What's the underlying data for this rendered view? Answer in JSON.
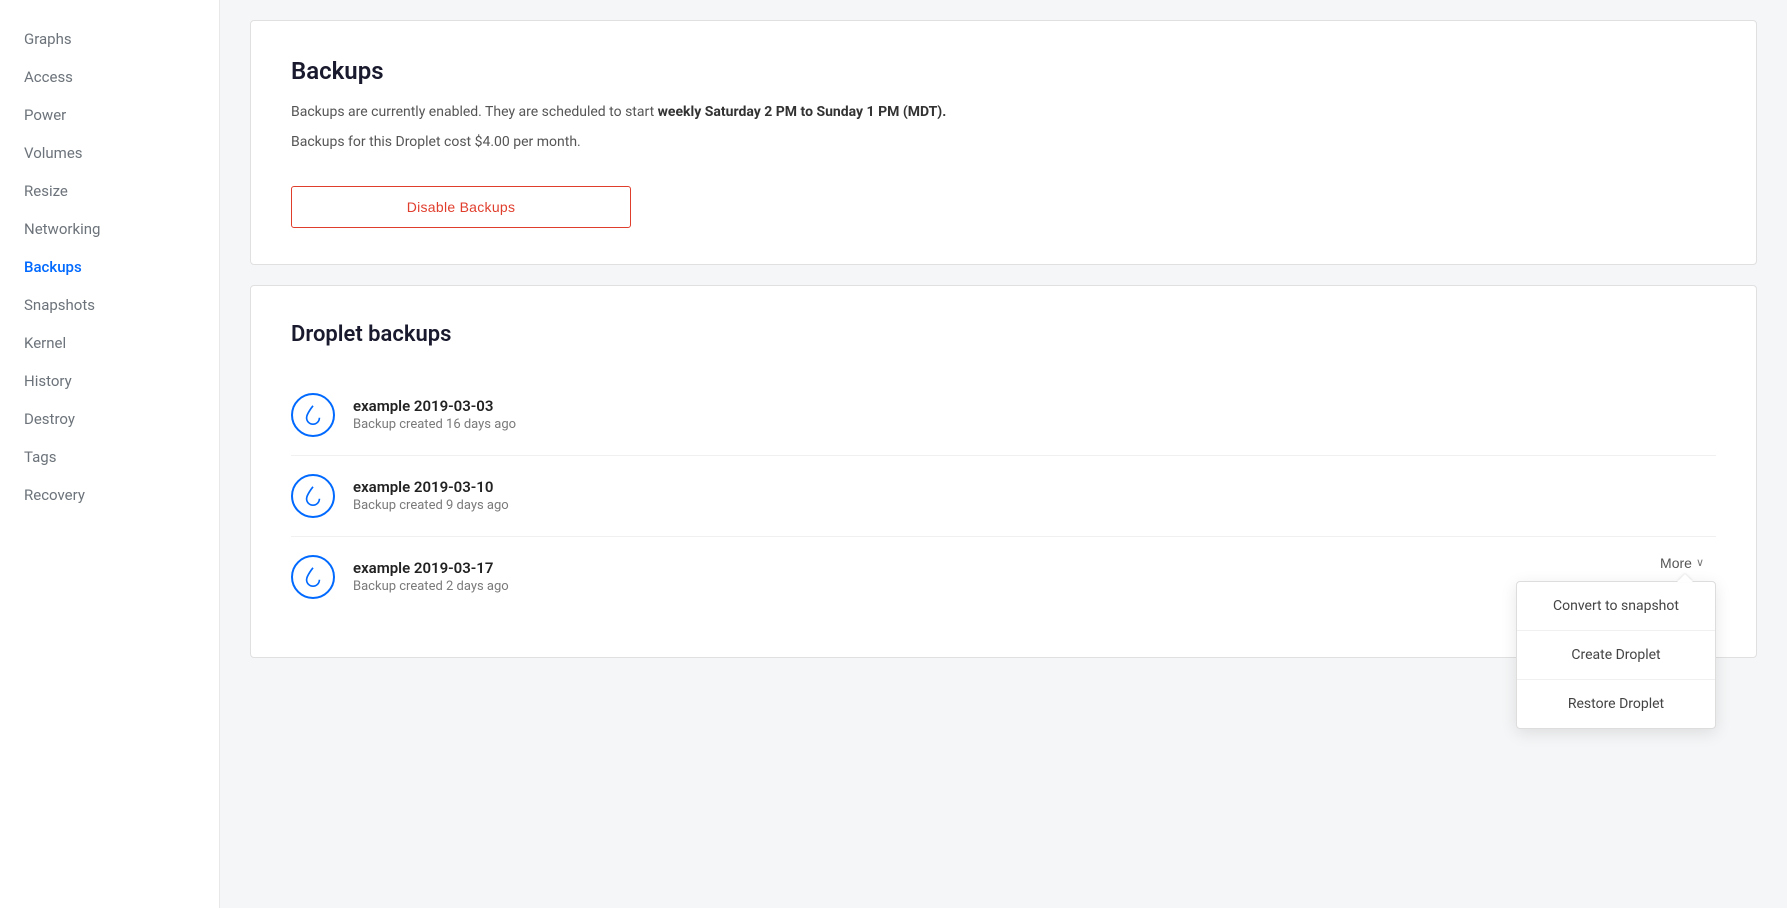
{
  "sidebar": {
    "items": [
      {
        "id": "graphs",
        "label": "Graphs",
        "active": false
      },
      {
        "id": "access",
        "label": "Access",
        "active": false
      },
      {
        "id": "power",
        "label": "Power",
        "active": false
      },
      {
        "id": "volumes",
        "label": "Volumes",
        "active": false
      },
      {
        "id": "resize",
        "label": "Resize",
        "active": false
      },
      {
        "id": "networking",
        "label": "Networking",
        "active": false
      },
      {
        "id": "backups",
        "label": "Backups",
        "active": true
      },
      {
        "id": "snapshots",
        "label": "Snapshots",
        "active": false
      },
      {
        "id": "kernel",
        "label": "Kernel",
        "active": false
      },
      {
        "id": "history",
        "label": "History",
        "active": false
      },
      {
        "id": "destroy",
        "label": "Destroy",
        "active": false
      },
      {
        "id": "tags",
        "label": "Tags",
        "active": false
      },
      {
        "id": "recovery",
        "label": "Recovery",
        "active": false
      }
    ]
  },
  "backups_header": {
    "title": "Backups",
    "desc1_prefix": "Backups are currently enabled. They are scheduled to start ",
    "desc1_bold": "weekly Saturday 2 PM to Sunday 1 PM (MDT).",
    "desc2": "Backups for this Droplet cost $4.00 per month.",
    "disable_btn": "Disable Backups"
  },
  "droplet_backups": {
    "title": "Droplet backups",
    "items": [
      {
        "name": "example 2019-03-03",
        "age": "Backup created 16 days ago"
      },
      {
        "name": "example 2019-03-10",
        "age": "Backup created 9 days ago"
      },
      {
        "name": "example 2019-03-17",
        "age": "Backup created 2 days ago"
      }
    ],
    "more_btn": "More",
    "dropdown": {
      "items": [
        "Convert to snapshot",
        "Create Droplet",
        "Restore Droplet"
      ]
    }
  }
}
